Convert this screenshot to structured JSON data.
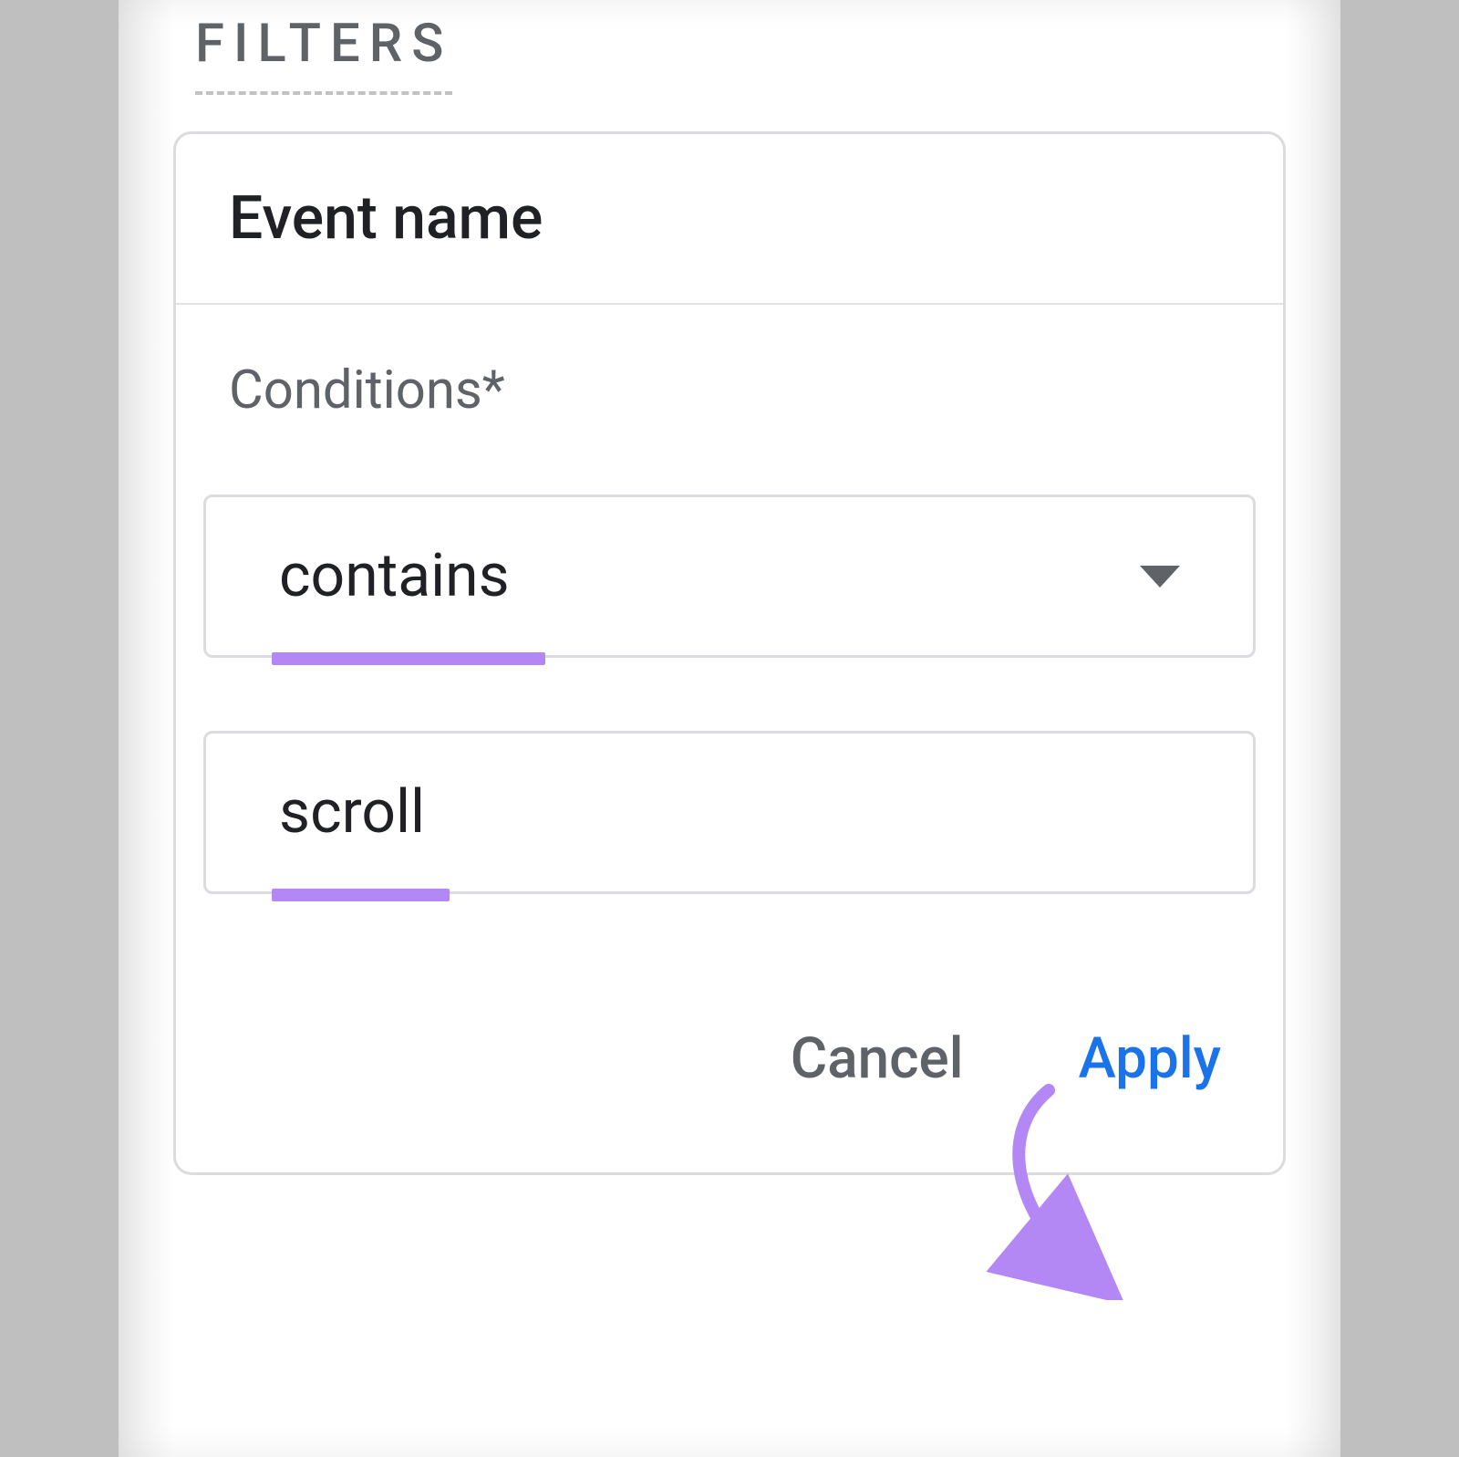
{
  "section_label": "FILTERS",
  "card": {
    "title": "Event name",
    "conditions_label": "Conditions*",
    "operator_select": {
      "value": "contains"
    },
    "value_input": {
      "value": "scroll"
    },
    "buttons": {
      "cancel": "Cancel",
      "apply": "Apply"
    }
  }
}
